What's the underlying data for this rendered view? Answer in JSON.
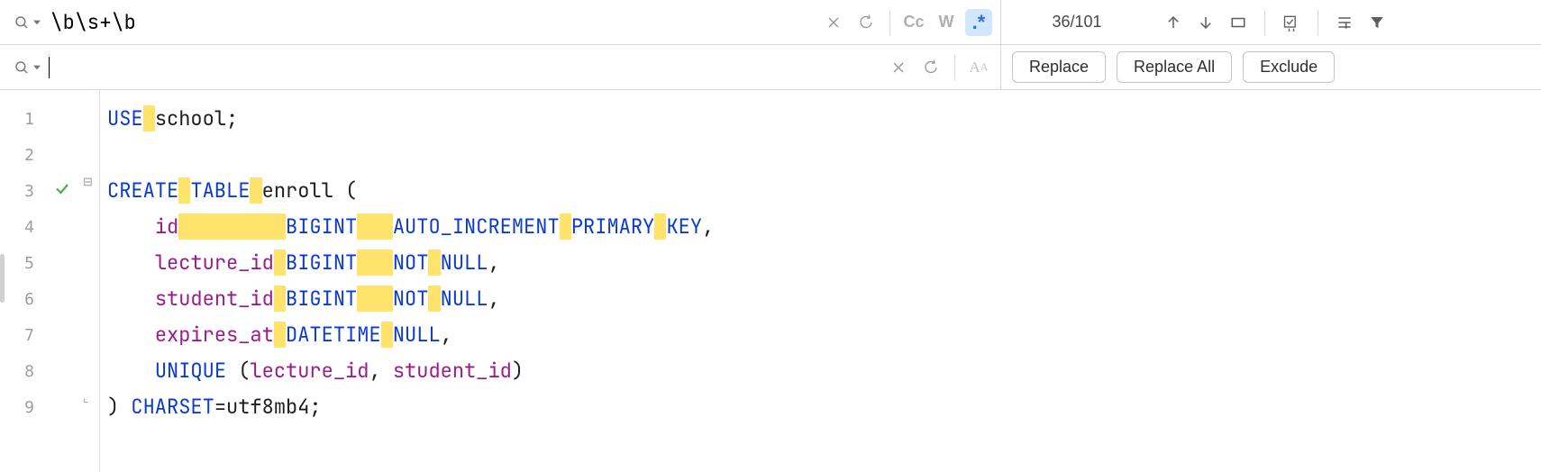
{
  "search": {
    "value": "\\b\\s+\\b",
    "close_tooltip": "Close",
    "options": {
      "case_label": "Cc",
      "words_label": "W",
      "regex_label": ".*",
      "regex_active": true
    },
    "count_label": "36/101"
  },
  "replace": {
    "value": "",
    "placeholder": "",
    "buttons": {
      "replace_label": "Replace",
      "replace_all_label": "Replace All",
      "exclude_label": "Exclude"
    }
  },
  "gutter": {
    "lines": [
      "1",
      "2",
      "3",
      "4",
      "5",
      "6",
      "7",
      "8",
      "9"
    ],
    "marks": {
      "3": "check"
    }
  },
  "code": {
    "lines": [
      {
        "indent": 0,
        "segs": [
          {
            "t": "USE",
            "c": "tok-kw"
          },
          {
            "t": " ",
            "hl": true
          },
          {
            "t": "school",
            "c": "tok-ident"
          },
          {
            "t": ";",
            "c": "tok-punct"
          }
        ]
      },
      {
        "indent": 0,
        "segs": []
      },
      {
        "indent": 0,
        "segs": [
          {
            "t": "CREATE",
            "c": "tok-kw"
          },
          {
            "t": " ",
            "hl": true
          },
          {
            "t": "TABLE",
            "c": "tok-kw"
          },
          {
            "t": " ",
            "hl": true
          },
          {
            "t": "enroll",
            "c": "tok-ident"
          },
          {
            "t": " (",
            "c": "tok-punct"
          }
        ]
      },
      {
        "indent": 4,
        "segs": [
          {
            "t": "id",
            "c": "tok-col"
          },
          {
            "t": "         ",
            "hl": true
          },
          {
            "t": "BIGINT",
            "c": "tok-kw"
          },
          {
            "t": "   ",
            "hl": true
          },
          {
            "t": "AUTO_INCREMENT",
            "c": "tok-kw"
          },
          {
            "t": " ",
            "hl": true
          },
          {
            "t": "PRIMARY",
            "c": "tok-kw"
          },
          {
            "t": " ",
            "hl": true
          },
          {
            "t": "KEY",
            "c": "tok-kw"
          },
          {
            "t": ",",
            "c": "tok-punct"
          }
        ]
      },
      {
        "indent": 4,
        "segs": [
          {
            "t": "lecture_id",
            "c": "tok-col"
          },
          {
            "t": " ",
            "hl": true
          },
          {
            "t": "BIGINT",
            "c": "tok-kw"
          },
          {
            "t": "   ",
            "hl": true
          },
          {
            "t": "NOT",
            "c": "tok-kw"
          },
          {
            "t": " ",
            "hl": true
          },
          {
            "t": "NULL",
            "c": "tok-kw"
          },
          {
            "t": ",",
            "c": "tok-punct"
          }
        ]
      },
      {
        "indent": 4,
        "segs": [
          {
            "t": "student_id",
            "c": "tok-col"
          },
          {
            "t": " ",
            "hl": true
          },
          {
            "t": "BIGINT",
            "c": "tok-kw"
          },
          {
            "t": "   ",
            "hl": true
          },
          {
            "t": "NOT",
            "c": "tok-kw"
          },
          {
            "t": " ",
            "hl": true
          },
          {
            "t": "NULL",
            "c": "tok-kw"
          },
          {
            "t": ",",
            "c": "tok-punct"
          }
        ]
      },
      {
        "indent": 4,
        "segs": [
          {
            "t": "expires_at",
            "c": "tok-col"
          },
          {
            "t": " ",
            "hl": true
          },
          {
            "t": "DATETIME",
            "c": "tok-kw"
          },
          {
            "t": " ",
            "hl": true
          },
          {
            "t": "NULL",
            "c": "tok-kw"
          },
          {
            "t": ",",
            "c": "tok-punct"
          }
        ]
      },
      {
        "indent": 4,
        "segs": [
          {
            "t": "UNIQUE",
            "c": "tok-kw"
          },
          {
            "t": " (",
            "c": "tok-punct"
          },
          {
            "t": "lecture_id",
            "c": "tok-col"
          },
          {
            "t": ", ",
            "c": "tok-punct"
          },
          {
            "t": "student_id",
            "c": "tok-col"
          },
          {
            "t": ")",
            "c": "tok-punct"
          }
        ]
      },
      {
        "indent": 0,
        "segs": [
          {
            "t": ") ",
            "c": "tok-punct"
          },
          {
            "t": "CHARSET",
            "c": "tok-kw"
          },
          {
            "t": "=",
            "c": "tok-punct"
          },
          {
            "t": "utf8mb4",
            "c": "tok-ident"
          },
          {
            "t": ";",
            "c": "tok-punct"
          }
        ]
      }
    ]
  }
}
